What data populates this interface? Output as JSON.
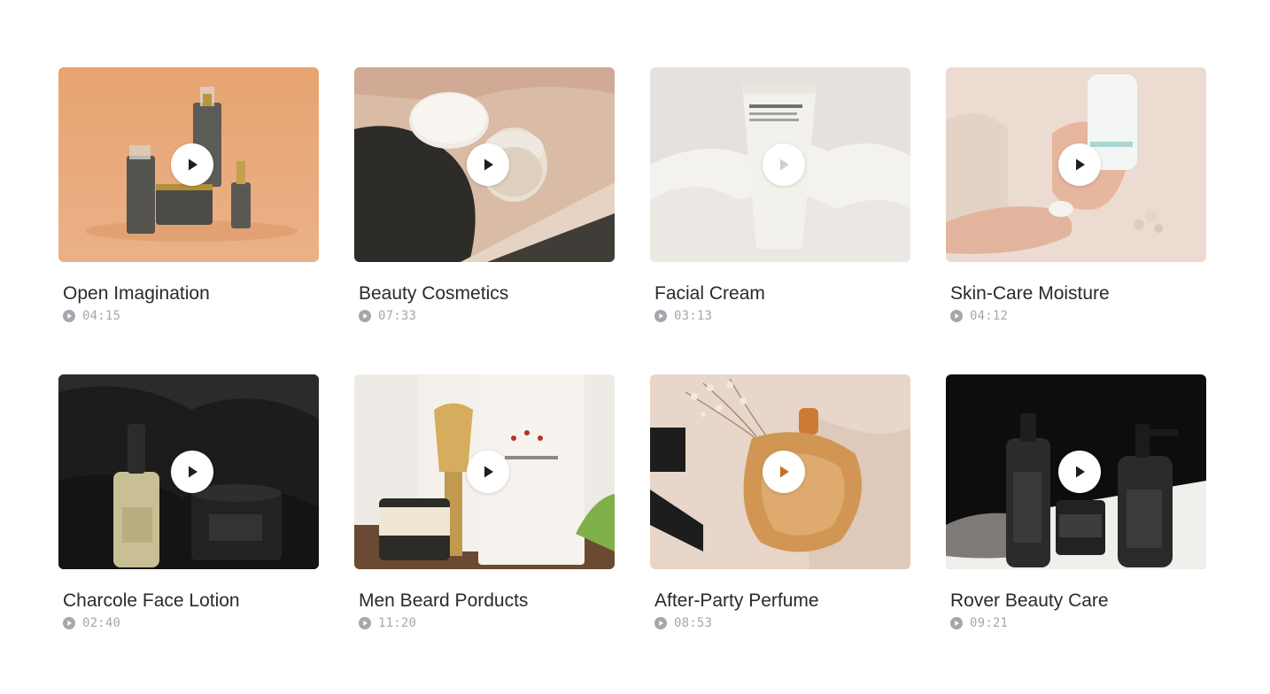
{
  "videos": [
    {
      "title": "Open Imagination",
      "duration": "04:15",
      "thumb_colors": [
        "#e7a878",
        "#d99a67"
      ]
    },
    {
      "title": "Beauty Cosmetics",
      "duration": "07:33",
      "thumb_colors": [
        "#d8b8a2",
        "#2f2d2a"
      ]
    },
    {
      "title": "Facial Cream",
      "duration": "03:13",
      "thumb_colors": [
        "#e4e1dd",
        "#f6f4f0"
      ]
    },
    {
      "title": "Skin-Care Moisture",
      "duration": "04:12",
      "thumb_colors": [
        "#e9d6c8",
        "#f1e2d6"
      ]
    },
    {
      "title": "Charcole Face Lotion",
      "duration": "02:40",
      "thumb_colors": [
        "#1c1c1c",
        "#2b2b2b"
      ]
    },
    {
      "title": "Men Beard Porducts",
      "duration": "11:20",
      "thumb_colors": [
        "#ece9e4",
        "#6b4a33"
      ]
    },
    {
      "title": "After-Party Perfume",
      "duration": "08:53",
      "thumb_colors": [
        "#e6d4c6",
        "#c98a45"
      ]
    },
    {
      "title": "Rover Beauty Care",
      "duration": "09:21",
      "thumb_colors": [
        "#111111",
        "#3a3a3a"
      ]
    }
  ],
  "colors": {
    "title": "#2a2a2a",
    "duration": "#a3a8ae",
    "play_button_bg": "#ffffff",
    "play_icon": "#1f1f1f"
  },
  "icons": {
    "play": "play-icon",
    "duration": "play-circle-icon"
  }
}
